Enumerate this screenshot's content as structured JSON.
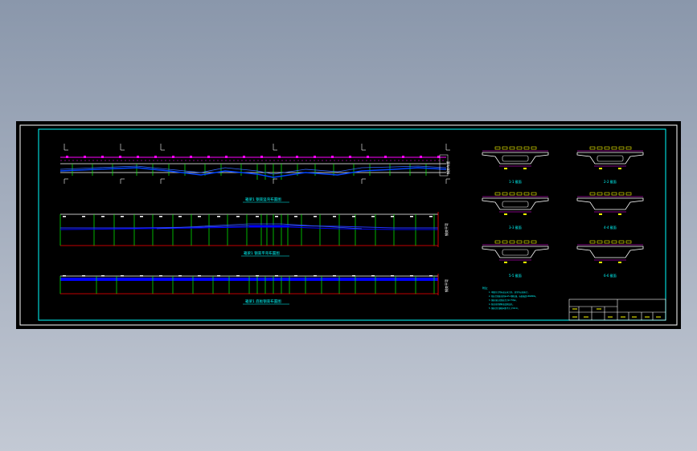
{
  "drawing": {
    "view_titles": [
      "箱梁1 钢束竖弯布置图",
      "箱梁1 钢束平弯布置图",
      "箱梁1 底板钢束布置图"
    ],
    "section_labels": [
      "1-1 截面",
      "2-2 截面",
      "3-3 截面",
      "4-4 截面",
      "5-5 截面",
      "6-6 截面"
    ],
    "notes_title": "附注：",
    "notes": [
      "1. 本图尺寸除标高以米计外，其余均以厘米计。",
      "2. 预应力钢束采用φs15.2钢绞线，标准强度1860MPa。",
      "3. 钢束张拉控制应力为0.75fpk。",
      "4. 管道采用塑料波纹管成孔。",
      "5. 钢束定位钢筋间距不大于50cm。"
    ],
    "side_labels": [
      "钢束布置",
      "钢束平弯",
      "钢束平弯"
    ],
    "colors": {
      "background": "#000000",
      "frame": "#00ffff",
      "tendon": "#0000ff",
      "ordinate": "#00ff00",
      "label": "#ff00ff",
      "dimension": "#ff0000",
      "table": "#ffffff"
    }
  }
}
